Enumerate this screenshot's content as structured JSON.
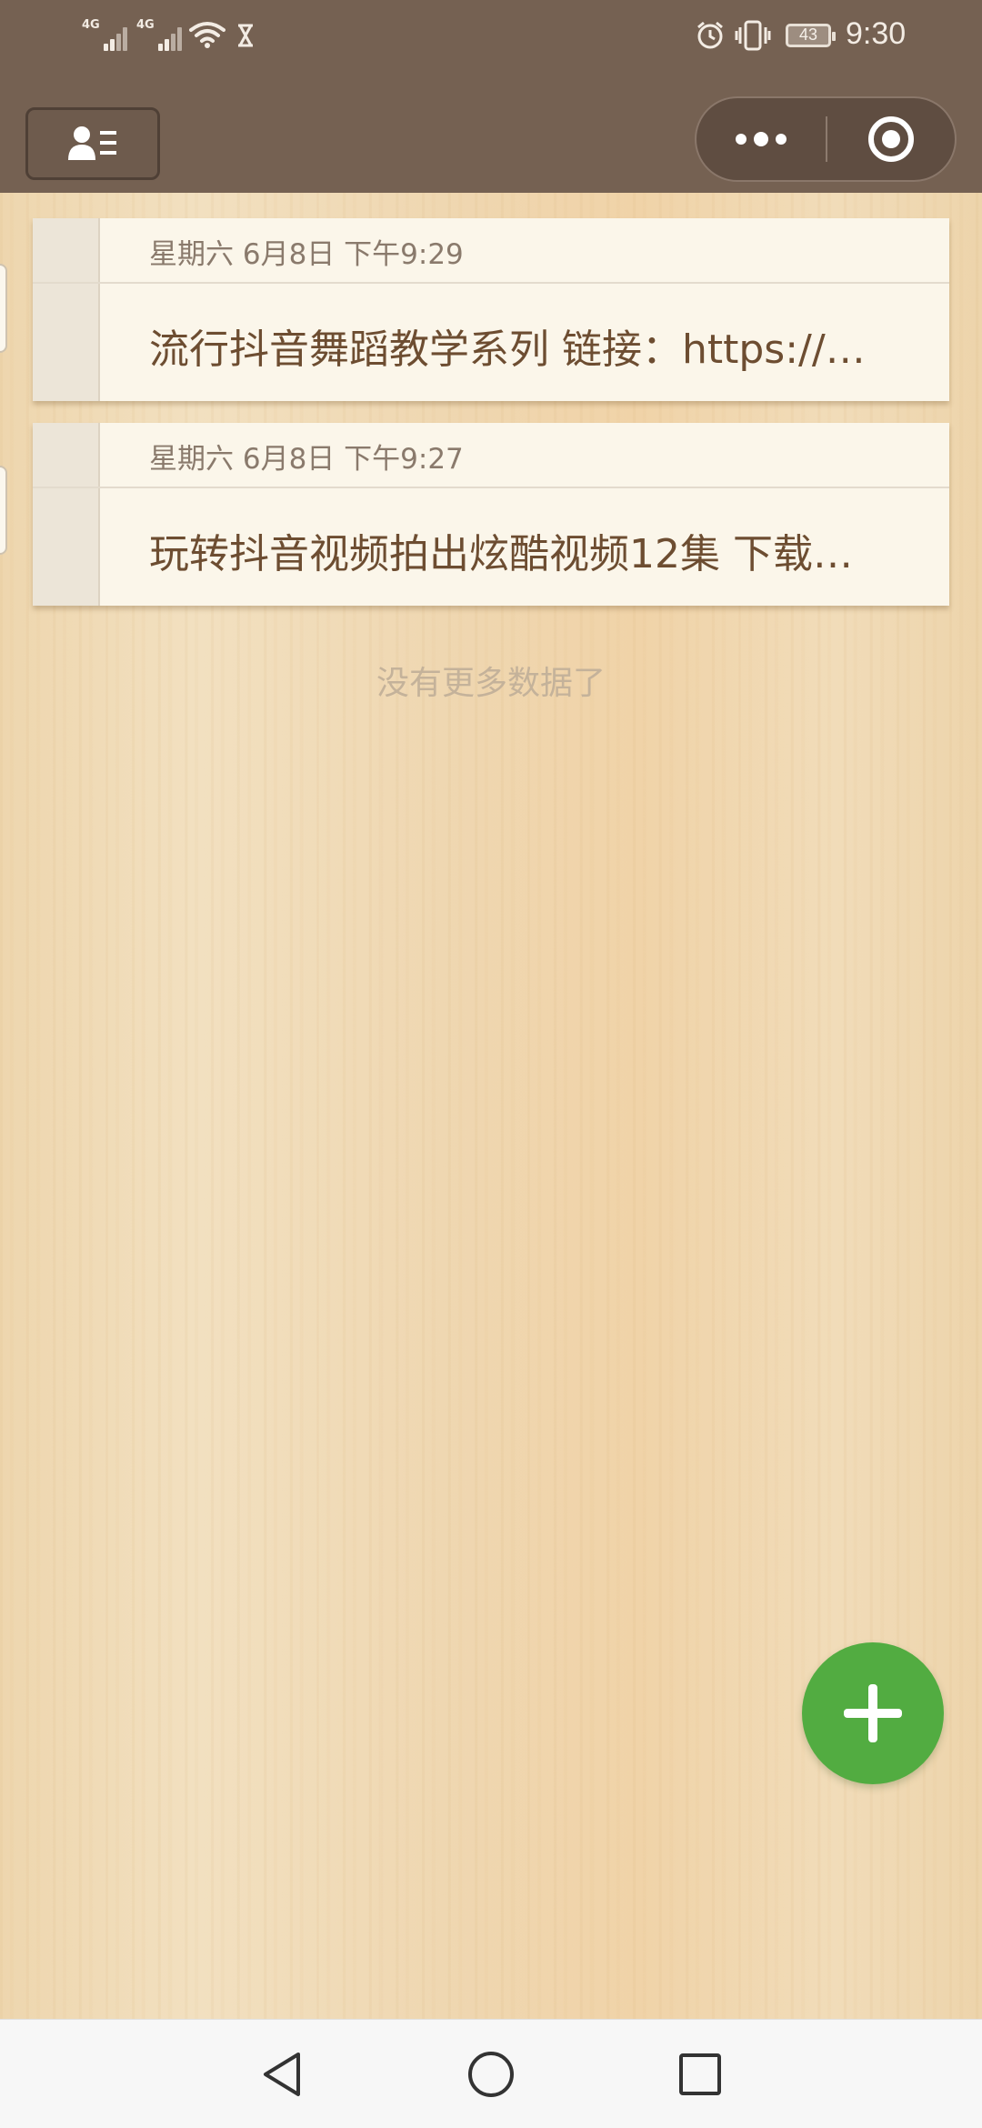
{
  "status_bar": {
    "network_1": "4G",
    "network_2": "4G",
    "battery": "43",
    "time": "9:30",
    "icons": [
      "signal-icon",
      "wifi-icon",
      "hourglass-icon",
      "alarm-icon",
      "vibrate-icon",
      "battery-icon"
    ]
  },
  "header": {
    "profile_icon": "contact-card-icon",
    "menu_icon": "more-dots-icon",
    "close_icon": "target-circle-icon"
  },
  "notes": [
    {
      "date": "星期六 6月8日 下午9:29",
      "title": "流行抖音舞蹈教学系列 链接：https://…"
    },
    {
      "date": "星期六 6月8日 下午9:27",
      "title": "玩转抖音视频拍出炫酷视频12集 下载…"
    }
  ],
  "list_footer": "没有更多数据了",
  "fab": {
    "icon": "plus-icon",
    "color": "#52ac41"
  },
  "theme": {
    "header_color": "#756152",
    "title_color": "#6d4d31"
  },
  "nav_bar": {
    "icons": [
      "back-triangle-icon",
      "home-circle-icon",
      "recent-square-icon"
    ]
  }
}
